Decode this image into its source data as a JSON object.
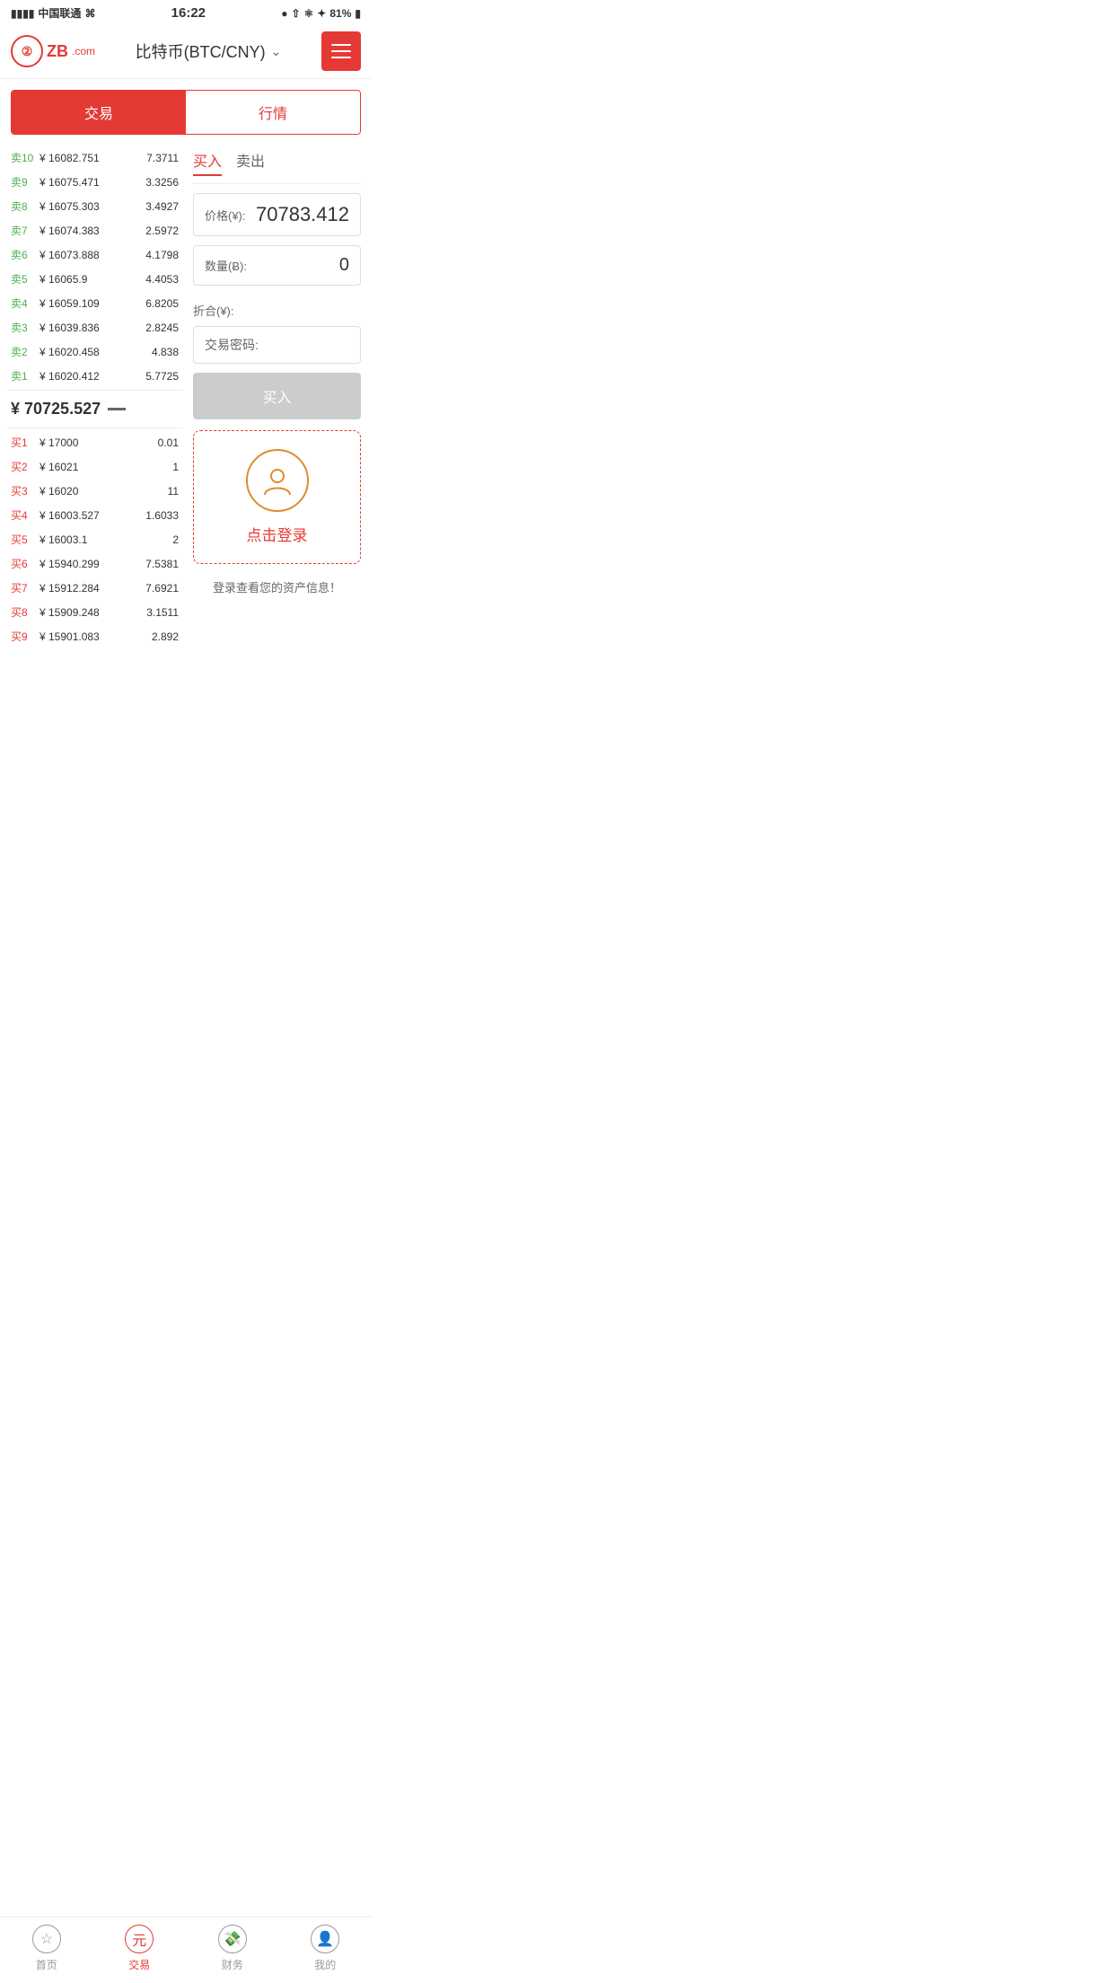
{
  "statusBar": {
    "carrier": "中国联通",
    "time": "16:22",
    "battery": "81%"
  },
  "header": {
    "logoText": "ZB",
    "logoCom": ".com",
    "title": "比特币(BTC/CNY)",
    "menuAriaLabel": "menu"
  },
  "tabs": {
    "active": "交易",
    "inactive": "行情"
  },
  "orderBook": {
    "sellOrders": [
      {
        "label": "卖10",
        "price": "¥ 16082.751",
        "amount": "7.3711"
      },
      {
        "label": "卖9",
        "price": "¥ 16075.471",
        "amount": "3.3256"
      },
      {
        "label": "卖8",
        "price": "¥ 16075.303",
        "amount": "3.4927"
      },
      {
        "label": "卖7",
        "price": "¥ 16074.383",
        "amount": "2.5972"
      },
      {
        "label": "卖6",
        "price": "¥ 16073.888",
        "amount": "4.1798"
      },
      {
        "label": "卖5",
        "price": "¥ 16065.9",
        "amount": "4.4053"
      },
      {
        "label": "卖4",
        "price": "¥ 16059.109",
        "amount": "6.8205"
      },
      {
        "label": "卖3",
        "price": "¥ 16039.836",
        "amount": "2.8245"
      },
      {
        "label": "卖2",
        "price": "¥ 16020.458",
        "amount": "4.838"
      },
      {
        "label": "卖1",
        "price": "¥ 16020.412",
        "amount": "5.7725"
      }
    ],
    "midPrice": "¥ 70725.527",
    "buyOrders": [
      {
        "label": "买1",
        "price": "¥ 17000",
        "amount": "0.01"
      },
      {
        "label": "买2",
        "price": "¥ 16021",
        "amount": "1"
      },
      {
        "label": "买3",
        "price": "¥ 16020",
        "amount": "11"
      },
      {
        "label": "买4",
        "price": "¥ 16003.527",
        "amount": "1.6033"
      },
      {
        "label": "买5",
        "price": "¥ 16003.1",
        "amount": "2"
      },
      {
        "label": "买6",
        "price": "¥ 15940.299",
        "amount": "7.5381"
      },
      {
        "label": "买7",
        "price": "¥ 15912.284",
        "amount": "7.6921"
      },
      {
        "label": "买8",
        "price": "¥ 15909.248",
        "amount": "3.1511"
      },
      {
        "label": "买9",
        "price": "¥ 15901.083",
        "amount": "2.892"
      }
    ]
  },
  "tradePanel": {
    "buyTab": "买入",
    "sellTab": "卖出",
    "priceLabel": "价格(¥):",
    "priceValue": "70783.412",
    "quantityLabel": "数量(Ƀ):",
    "quantityValue": "0",
    "totalLabel": "折合(¥):",
    "totalValue": "",
    "passwordLabel": "交易密码:",
    "buyButton": "买入"
  },
  "loginPrompt": {
    "loginText": "点击登录",
    "assetInfo": "登录查看您的资产信息！"
  },
  "bottomNav": [
    {
      "label": "首页",
      "icon": "star",
      "active": false
    },
    {
      "label": "交易",
      "icon": "yen",
      "active": true
    },
    {
      "label": "财务",
      "icon": "bag",
      "active": false
    },
    {
      "label": "我的",
      "icon": "person",
      "active": false
    }
  ]
}
